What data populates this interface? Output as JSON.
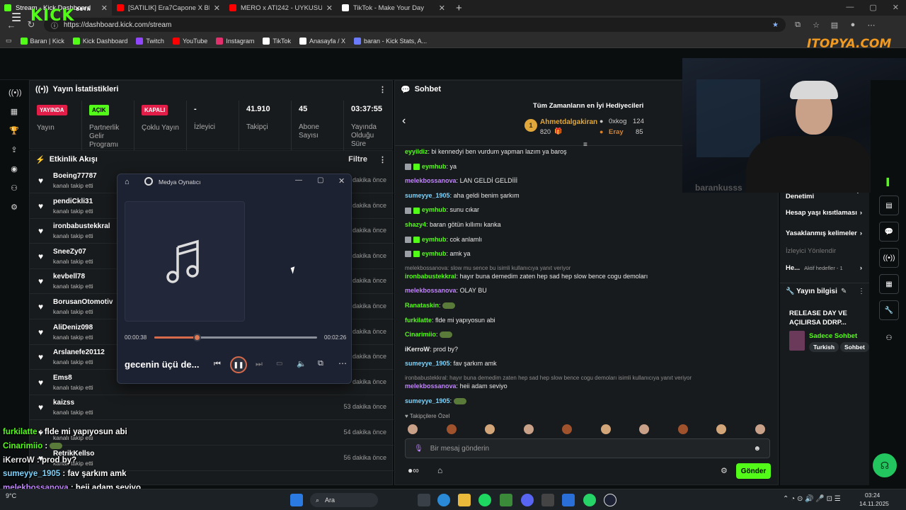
{
  "browser": {
    "tabs": [
      {
        "title": "Stream - Kick Dashboard",
        "active": true,
        "color": "#53fc18"
      },
      {
        "title": "[SATILIK] Era7Capone X Blok3 Typ",
        "active": false,
        "color": "#ff0000"
      },
      {
        "title": "MERO x ATI242 - UYKUSUZ GECE",
        "active": false,
        "color": "#ff0000"
      },
      {
        "title": "TikTok - Make Your Day",
        "active": false,
        "color": "#ffffff"
      }
    ],
    "url": "https://dashboard.kick.com/stream",
    "bookmarks": [
      "Baran | Kick",
      "Kick Dashboard",
      "Twitch",
      "YouTube",
      "Instagram",
      "TikTok",
      "Anasayfa / X",
      "baran - Kick Stats, A..."
    ]
  },
  "kick": {
    "logo": "KICK",
    "beta": "BETA"
  },
  "watermark": "ITOPYA.COM",
  "stats": {
    "title": "Yayın İstatistikleri",
    "cols": [
      {
        "badge": "YAYINDA",
        "badge_color": "#e11d48",
        "label": "Yayın"
      },
      {
        "badge": "AÇIK",
        "badge_color": "#53fc18",
        "label": "Partnerlik Gelir Programı"
      },
      {
        "badge": "KAPALI",
        "badge_color": "#e11d48",
        "label": "Çoklu Yayın"
      },
      {
        "value": "-",
        "label": "İzleyici"
      },
      {
        "value": "41.910",
        "label": "Takipçi"
      },
      {
        "value": "45",
        "label": "Abone Sayısı"
      },
      {
        "value": "03:37:55",
        "label": "Yayında Olduğu Süre"
      }
    ]
  },
  "activity": {
    "title": "Etkinlik Akışı",
    "filter": "Filtre",
    "rows": [
      {
        "name": "Boeing77787",
        "sub": "kanalı takip etti",
        "time": "dakika önce"
      },
      {
        "name": "pendiCkli31",
        "sub": "kanalı takip etti",
        "time": "dakika önce"
      },
      {
        "name": "ironbabustekkral",
        "sub": "kanalı takip etti",
        "time": "dakika önce"
      },
      {
        "name": "SneeZy07",
        "sub": "kanalı takip etti",
        "time": "dakika önce"
      },
      {
        "name": "kevbell78",
        "sub": "kanalı takip etti",
        "time": "dakika önce"
      },
      {
        "name": "BorusanOtomotiv",
        "sub": "kanalı takip etti",
        "time": "dakika önce"
      },
      {
        "name": "AliDeniz098",
        "sub": "kanalı takip etti",
        "time": "dakika önce"
      },
      {
        "name": "Arslanefe20112",
        "sub": "kanalı takip etti",
        "time": "dakika önce"
      },
      {
        "name": "Ems8",
        "sub": "kanalı takip etti",
        "time": "dakika önce"
      },
      {
        "name": "kaizss",
        "sub": "kanalı takip etti",
        "time": "53 dakika önce"
      },
      {
        "name": "",
        "sub": "kanalı takip etti",
        "time": "54 dakika önce"
      },
      {
        "name": "RetrikKellso",
        "sub": "kanalı takip etti",
        "time": "56 dakika önce"
      }
    ]
  },
  "player": {
    "title": "Medya Oynatıcı",
    "elapsed": "00:00:38",
    "duration": "00:02:26",
    "progress": 0.26,
    "track": "gecenin üçü de..."
  },
  "chat": {
    "title": "Sohbet",
    "gifters_title": "Tüm Zamanların en İyi Hediyecileri",
    "top": {
      "rank": "1",
      "name": "Ahmetdalgakiran",
      "amount": "820"
    },
    "second": {
      "name": "0xkog",
      "amount": "124"
    },
    "third": {
      "name": "Eray",
      "amount": "85"
    },
    "messages": [
      {
        "kind": "msg",
        "user": "eyyildiz",
        "color": "#53fc18",
        "text": "bi kennedyi ben vurdum yapman lazım ya baroş",
        "badges": 0
      },
      {
        "kind": "msg",
        "user": "eymhub",
        "color": "#53fc18",
        "text": "ya",
        "badges": 2
      },
      {
        "kind": "msg",
        "user": "melekbossanova",
        "color": "#c084fc",
        "text": "LAN GELDİ GELDİİİ",
        "badges": 0
      },
      {
        "kind": "msg",
        "user": "sumeyye_1905",
        "color": "#7dd3fc",
        "text": "aha geldi benim şarkım",
        "badges": 0
      },
      {
        "kind": "msg",
        "user": "eymhub",
        "color": "#53fc18",
        "text": "sunu cıkar",
        "badges": 2
      },
      {
        "kind": "msg",
        "user": "shazy4",
        "color": "#53fc18",
        "text": "baran götün kıllımı kanka",
        "badges": 0
      },
      {
        "kind": "msg",
        "user": "eymhub",
        "color": "#53fc18",
        "text": "cok anlamlı",
        "badges": 2
      },
      {
        "kind": "msg",
        "user": "eymhub",
        "color": "#53fc18",
        "text": "amk ya",
        "badges": 2
      },
      {
        "kind": "reply",
        "text": "melekbossanova: slow mu sence bu isimli kullanıcıya yanıt veriyor"
      },
      {
        "kind": "msg",
        "user": "ironbabustekkral",
        "color": "#53fc18",
        "text": "hayır buna demedim zaten hep sad hep slow bence cogu demoları",
        "badges": 0
      },
      {
        "kind": "msg",
        "user": "melekbossanova",
        "color": "#c084fc",
        "text": "OLAY BU",
        "badges": 0
      },
      {
        "kind": "msg",
        "user": "Ranataskin",
        "color": "#53fc18",
        "text": "",
        "emote": true,
        "badges": 0
      },
      {
        "kind": "msg",
        "user": "furkilatte",
        "color": "#53fc18",
        "text": "flde mi yapıyosun abi",
        "badges": 0
      },
      {
        "kind": "msg",
        "user": "Cinarimiio",
        "color": "#53fc18",
        "text": "",
        "emote": true,
        "badges": 0
      },
      {
        "kind": "msg",
        "user": "iKerroW",
        "color": "#e8e8e8",
        "text": "prod by?",
        "badges": 0
      },
      {
        "kind": "msg",
        "user": "sumeyye_1905",
        "color": "#7dd3fc",
        "text": "fav şarkım amk",
        "badges": 0
      },
      {
        "kind": "reply",
        "text": "ironbabustekkral: hayır buna demedim zaten hep sad hep slow bence cogu demoları isimli kullanıcıya yanıt veriyor"
      },
      {
        "kind": "msg",
        "user": "melekbossanova",
        "color": "#c084fc",
        "text": "heii adam seviyo",
        "badges": 0
      },
      {
        "kind": "msg",
        "user": "sumeyye_1905",
        "color": "#7dd3fc",
        "text": "",
        "emote": true,
        "badges": 0
      }
    ],
    "followers_only": "Takipçilere Özel",
    "placeholder": "Bir mesaj gönderin",
    "send": "Gönder"
  },
  "right": {
    "cam_name": "barankusss",
    "menu": [
      {
        "label": "Yapay Zeka ile Sohbet Denetimi",
        "kind": "link"
      },
      {
        "label": "Hesap yaşı kısıtlaması",
        "kind": "chev"
      },
      {
        "label": "Yasaklanmış kelimeler",
        "kind": "chev"
      },
      {
        "label": "İzleyici Yönlendir",
        "kind": "dim"
      },
      {
        "label": "He...",
        "kind": "goal",
        "extra": "Aktif hedefler - 1"
      }
    ],
    "info_title": "Yayın bilgisi",
    "stream_title": "RELEASE DAY VE AÇILIRSA DDRP...",
    "category": "Sadece Sohbet",
    "tags": [
      "Turkish",
      "Sohbet"
    ]
  },
  "overlay": [
    {
      "user": "furkilatte",
      "color": "#53fc18",
      "text": "flde mi yapıyosun abi"
    },
    {
      "user": "Cinarimiio",
      "color": "#53fc18",
      "text": ""
    },
    {
      "user": "iKerroW",
      "color": "#e8e8e8",
      "text": "prod by?"
    },
    {
      "user": "sumeyye_1905",
      "color": "#7dd3fc",
      "text": "fav şarkım amk"
    },
    {
      "user": "melekbossanova",
      "color": "#c084fc",
      "text": "heii adam seviyo"
    },
    {
      "user": "sumeyye_1905",
      "color": "#7dd3fc",
      "text": ""
    }
  ],
  "taskbar": {
    "search": "Ara",
    "weather": "9°C",
    "time": "03:24",
    "date": "14.11.2025"
  }
}
